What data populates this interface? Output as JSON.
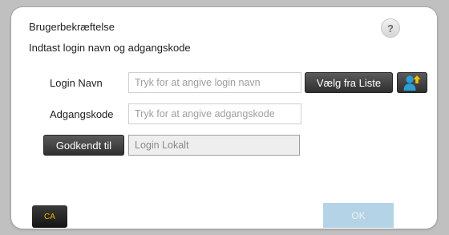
{
  "dialog": {
    "title": "Brugerbekræftelse",
    "subtitle": "Indtast login navn og adgangskode",
    "help_label": "?"
  },
  "form": {
    "login_name": {
      "label": "Login Navn",
      "placeholder": "Tryk for at angive login navn"
    },
    "password": {
      "label": "Adgangskode",
      "placeholder": "Tryk for at angive adgangskode"
    },
    "select_from_list_label": "Vælg fra Liste",
    "user_list_icon": "user-add-icon",
    "authenticate_to": {
      "button_label": "Godkendt til",
      "value": "Login Lokalt"
    }
  },
  "footer": {
    "ca_label": "CA",
    "ok_label": "OK"
  },
  "colors": {
    "ca_text": "#f0b400",
    "ok_disabled_bg": "#b5d3e6",
    "user_icon": "#2a9fd6",
    "arrow_icon": "#f2c200"
  }
}
